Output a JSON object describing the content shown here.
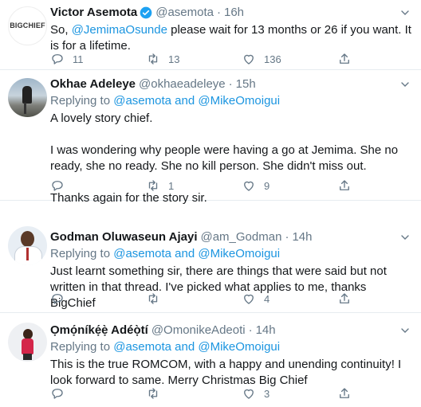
{
  "tweets": [
    {
      "name": "Victor Asemota",
      "verified": true,
      "handle": "@asemota",
      "time": "16h",
      "avatar_logo": "BIGCHIEF",
      "text_parts": [
        "So, ",
        "@JemimaOsunde",
        " please wait for 13 months or 26 if you want. It is for a lifetime."
      ],
      "counts": {
        "reply": "11",
        "retweet": "13",
        "like": "136"
      }
    },
    {
      "name": "Okhae Adeleye",
      "handle": "@okhaeadeleye",
      "time": "15h",
      "replying": {
        "prefix": "Replying to ",
        "user1": "@asemota",
        "and": " and ",
        "user2": "@MikeOmoigui"
      },
      "paragraphs": [
        "A lovely story chief.",
        "I was wondering why people were having a go at Jemima. She no ready, she no ready. She no kill person. She didn't miss out.",
        "Thanks again for the story sir."
      ],
      "counts": {
        "reply": "",
        "retweet": "1",
        "like": "9"
      }
    },
    {
      "name": "Godman Oluwaseun Ajayi",
      "handle": "@am_Godman",
      "time": "14h",
      "replying": {
        "prefix": "Replying to ",
        "user1": "@asemota",
        "and": " and ",
        "user2": "@MikeOmoigui"
      },
      "paragraphs": [
        "Just learnt something sir, there are things that were said but not written in that thread. I've picked what applies to me, thanks BigChief"
      ],
      "counts": {
        "reply": "",
        "retweet": "",
        "like": "4"
      }
    },
    {
      "name": "Ọmọ́níkẹ́ẹ̀ Adéọ̀tí",
      "handle": "@OmonikeAdeoti",
      "time": "14h",
      "replying": {
        "prefix": "Replying to ",
        "user1": "@asemota",
        "and": " and ",
        "user2": "@MikeOmoigui"
      },
      "paragraphs": [
        "This is the true ROMCOM, with a happy and unending continuity! I look forward to same. Merry Christmas Big Chief"
      ],
      "counts": {
        "reply": "",
        "retweet": "",
        "like": "3"
      }
    }
  ],
  "colors": {
    "link": "#1b95e0",
    "muted": "#657786",
    "text": "#14171a",
    "divider": "#e6ecf0"
  },
  "icons": [
    "reply-icon",
    "retweet-icon",
    "like-icon",
    "share-icon",
    "verified-badge-icon",
    "chevron-down-icon"
  ]
}
